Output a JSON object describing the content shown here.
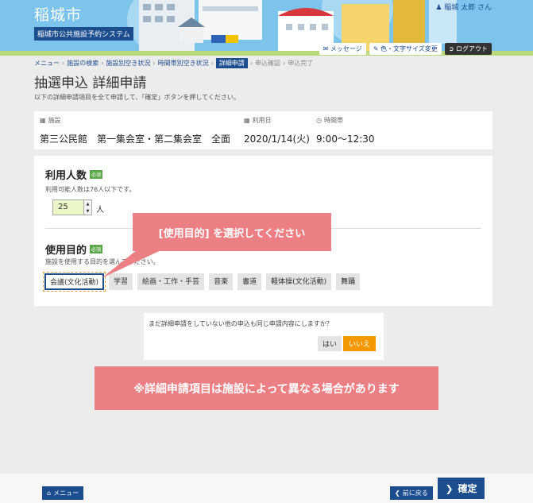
{
  "header": {
    "city": "稲城市",
    "system_name": "稲城市公共施設予約システム",
    "user": "稲城 太郎 さん",
    "message_btn": "メッセージ",
    "color_btn": "色・文字サイズ変更",
    "logout_btn": "ログアウト"
  },
  "breadcrumb": {
    "items": [
      "メニュー",
      "施設の検索",
      "施設別空き状況",
      "時間帯別空き状況"
    ],
    "current": "詳細申請",
    "rest": [
      "申込確認",
      "申込完了"
    ]
  },
  "page": {
    "title": "抽選申込 詳細申請",
    "lead": "以下の詳細申請項目を全て申請して、「確定」ボタンを押してください。"
  },
  "facility": {
    "label_facility": "施設",
    "label_date": "利用日",
    "label_time": "時間帯",
    "facility": "第三公民館　第一集会室・第二集会室　全面",
    "date": "2020/1/14(火)",
    "time": "9:00〜12:30"
  },
  "users_count": {
    "title": "利用人数",
    "required": "必須",
    "note": "利用可能人数は76人以下です。",
    "value": "25",
    "unit": "人"
  },
  "purpose": {
    "title": "使用目的",
    "required": "必須",
    "note": "施設を使用する目的を選んでください。",
    "options": [
      "会議(文化活動)",
      "学習",
      "絵画・工作・手芸",
      "音楽",
      "書道",
      "軽体操(文化活動)",
      "舞踊"
    ]
  },
  "callout": "[使用目的] を選択してください",
  "confirm": {
    "question": "まだ詳細申請をしていない他の申込も同じ申請内容にしますか？",
    "yes": "はい",
    "no": "いいえ"
  },
  "notice": "※詳細申請項目は施設によって異なる場合があります",
  "footer": {
    "menu": "メニュー",
    "back": "前に戻る",
    "confirm": "確定"
  }
}
